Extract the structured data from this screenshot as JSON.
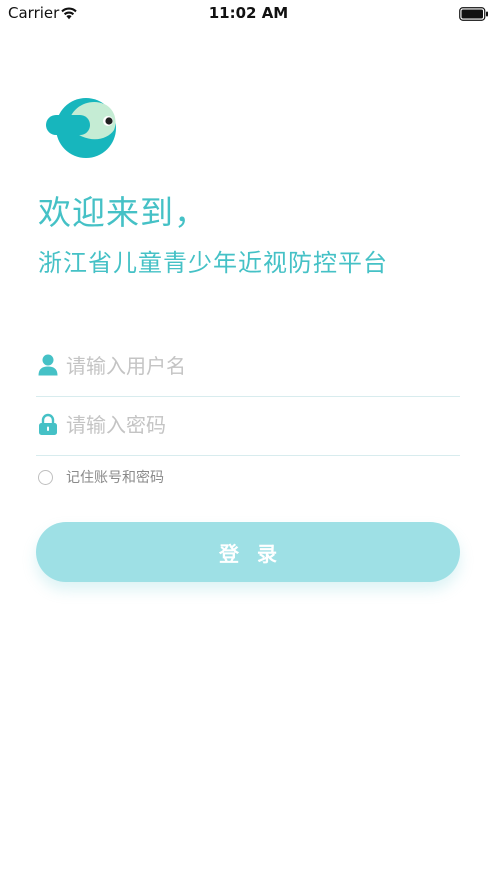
{
  "status_bar": {
    "carrier": "Carrier",
    "time": "11:02 AM",
    "wifi_icon": "wifi-icon",
    "battery_icon": "battery-icon"
  },
  "logo": {
    "icon": "fish-logo-icon",
    "colors": {
      "body": "#17b6bd",
      "face": "#c5ecd4",
      "eye": "#222222"
    }
  },
  "welcome": {
    "greeting": "欢迎来到，",
    "platform_name": "浙江省儿童青少年近视防控平台"
  },
  "form": {
    "username": {
      "icon": "user-icon",
      "value": "",
      "placeholder": "请输入用户名"
    },
    "password": {
      "icon": "lock-icon",
      "value": "",
      "placeholder": "请输入密码"
    },
    "remember": {
      "label": "记住账号和密码",
      "checked": false
    },
    "login_label": "登录"
  },
  "colors": {
    "accent": "#45c1c6",
    "button": "#9ee0e5",
    "icon": "#45c1c6",
    "divider": "#d8ecee"
  }
}
